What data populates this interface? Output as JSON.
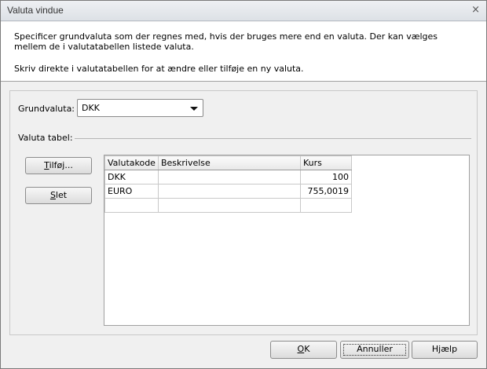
{
  "window": {
    "title": "Valuta vindue",
    "close_glyph": "×"
  },
  "info": {
    "line1": "Specificer grundvaluta som der regnes med, hvis der bruges mere end en valuta. Der kan vælges",
    "line2": "mellem de i valutatabellen listede valuta.",
    "line3": "Skriv direkte i valutatabellen for at ændre eller tilføje en ny valuta."
  },
  "base_currency": {
    "label": "Grundvaluta:",
    "value": "DKK"
  },
  "table_group": {
    "label": "Valuta tabel:"
  },
  "buttons": {
    "add": {
      "mnemonic": "T",
      "rest": "ilføj..."
    },
    "delete": {
      "mnemonic": "S",
      "rest": "let"
    },
    "ok": {
      "mnemonic": "O",
      "rest": "K"
    },
    "cancel": "Annuller",
    "help": "Hjælp"
  },
  "grid": {
    "columns": [
      "Valutakode",
      "Beskrivelse",
      "Kurs"
    ],
    "rows": [
      {
        "code": "DKK",
        "description": "",
        "rate": "100"
      },
      {
        "code": "EURO",
        "description": "",
        "rate": "755,0019"
      },
      {
        "code": "",
        "description": "",
        "rate": ""
      }
    ]
  }
}
